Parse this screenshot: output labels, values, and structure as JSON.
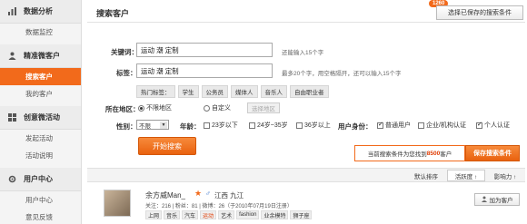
{
  "sidebar": {
    "sections": [
      {
        "title": "数据分析",
        "icon": "chart-icon",
        "items": [
          "数据监控"
        ]
      },
      {
        "title": "精准微客户",
        "icon": "person-icon",
        "items": [
          "搜索客户",
          "我的客户"
        ]
      },
      {
        "title": "创意微活动",
        "icon": "grid-icon",
        "items": [
          "发起活动",
          "活动说明"
        ]
      },
      {
        "title": "用户中心",
        "icon": "gear-icon",
        "items": [
          "用户中心",
          "意见反馈"
        ]
      }
    ],
    "active_item": "搜索客户"
  },
  "header": {
    "title": "搜索客户",
    "saved_button": "选择已保存的搜索条件",
    "badge": "1260"
  },
  "form": {
    "keyword_label": "关键词：",
    "keyword_value": "运动 潮 定制",
    "keyword_hint": "还能输入15个字",
    "tag_label": "标签：",
    "tag_value": "运动 潮 定制",
    "tag_hint": "最多20个字，用空格隔开，还可以输入15个字",
    "hot_tags_label": "热门标签：",
    "hot_tags": [
      "学生",
      "公务员",
      "媒体人",
      "音乐人",
      "自由职业者"
    ],
    "region_label": "所在地区：",
    "region_options": [
      "不限地区",
      "自定义"
    ],
    "region_button": "选择地区",
    "gender_label": "性别：",
    "gender_value": "不限",
    "age_label": "年龄：",
    "age_options": [
      "23岁以下",
      "24岁~35岁",
      "36岁以上"
    ],
    "identity_label": "用户身份：",
    "identity_options": [
      "普通用户",
      "企业/机构认证",
      "个人认证"
    ],
    "search_button": "开始搜索"
  },
  "result": {
    "prefix": "当前搜索条件为您找到",
    "count": "8500",
    "suffix": "客户",
    "save_button": "保存搜索条件"
  },
  "sort": {
    "options": [
      "默认排序",
      "活跃度 ↑",
      "影响力 ↑"
    ],
    "active": "活跃度 ↑"
  },
  "users": [
    {
      "name": "余方威Man_",
      "gender": "♂",
      "location": "江西 九江",
      "stats": "关注：216 | 粉丝：81 | 微博：26（于2010年07月19日注册）",
      "tags": [
        "上网",
        "音乐",
        "汽车",
        "运动",
        "艺术",
        "fashion",
        "业余模特",
        "狮子座"
      ],
      "add_button": "加为客户"
    }
  ],
  "colors": {
    "accent": "#f26a1b",
    "highlight": "#e03a00",
    "link": "#2a6ac6"
  }
}
